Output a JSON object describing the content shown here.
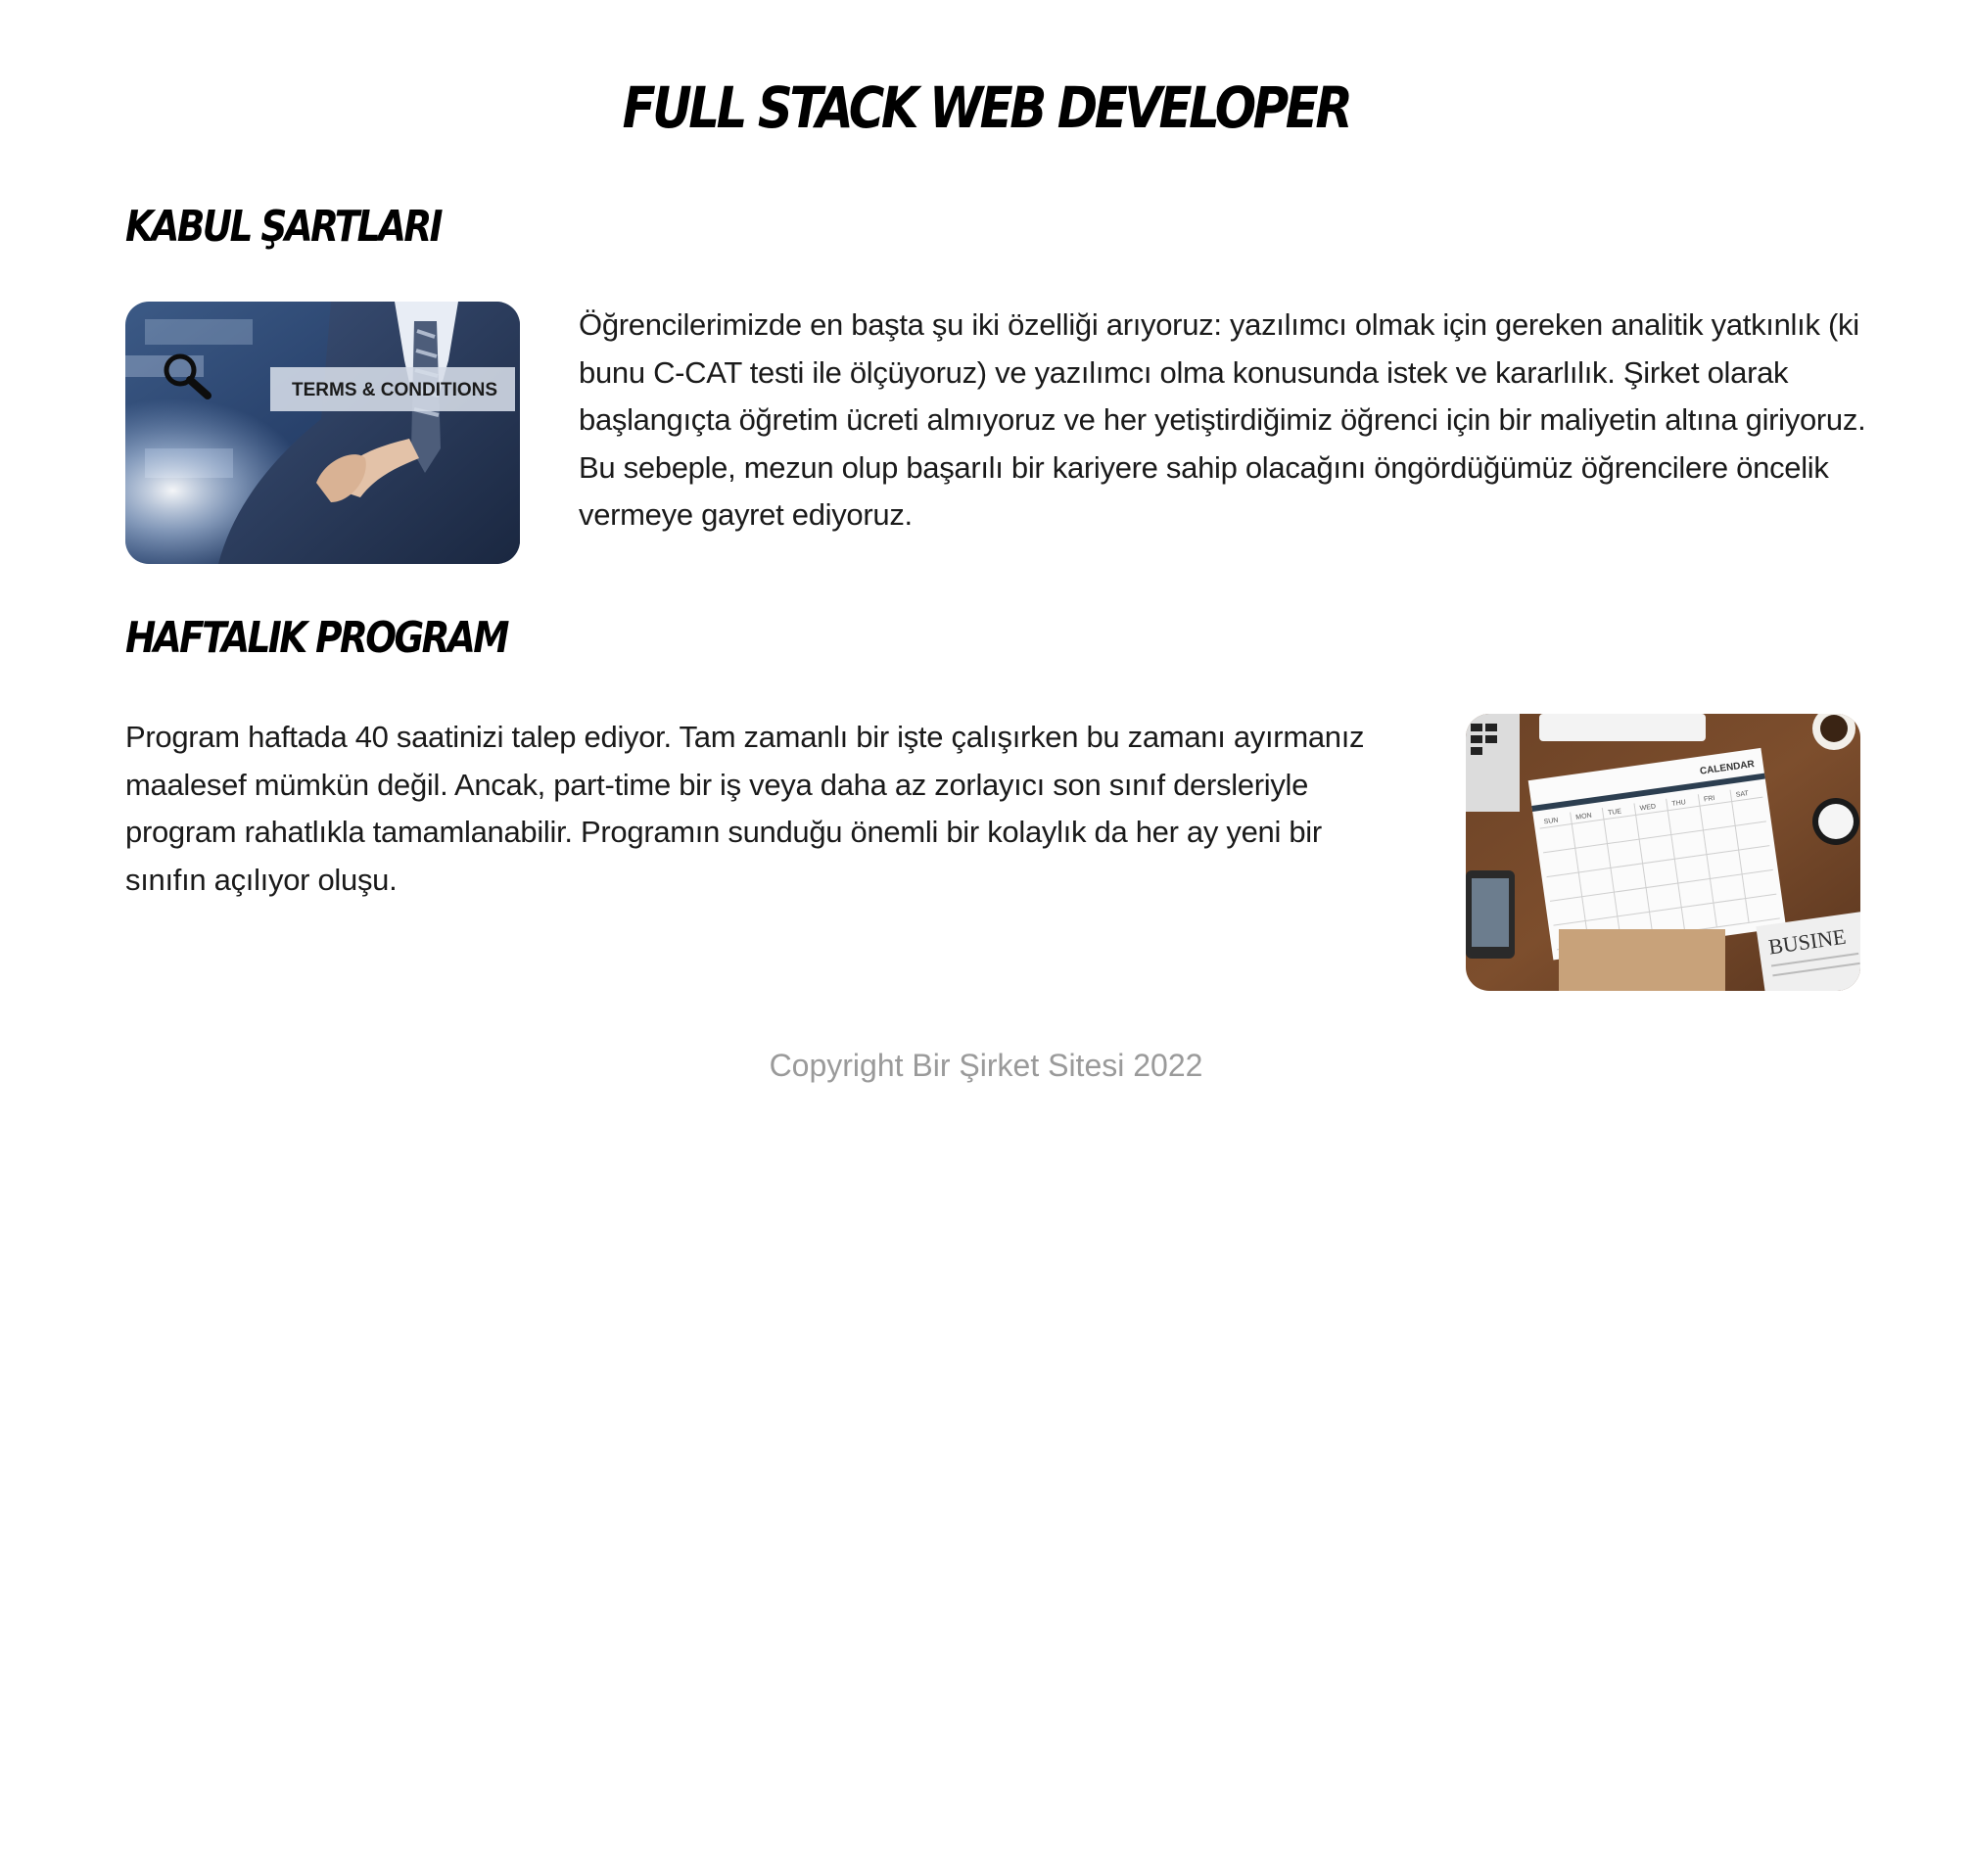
{
  "page": {
    "title": "FULL STACK WEB DEVELOPER"
  },
  "sections": [
    {
      "heading": "KABUL ŞARTLARI",
      "text": "Öğrencilerimizde en başta şu iki özelliği arıyoruz: yazılımcı olmak için gereken analitik yatkınlık (ki bunu C-CAT testi ile ölçüyoruz) ve yazılımcı olma konusunda istek ve kararlılık. Şirket olarak başlangıçta öğretim ücreti almıyoruz ve her yetiştirdiğimiz öğrenci için bir maliyetin altına giriyoruz. Bu sebeple, mezun olup başarılı bir kariyere sahip olacağını öngördüğümüz öğrencilere öncelik vermeye gayret ediyoruz.",
      "image": {
        "icon": "terms-conditions-photo",
        "caption": "TERMS & CONDITIONS"
      }
    },
    {
      "heading": "HAFTALIK PROGRAM",
      "text": "Program haftada 40 saatinizi talep ediyor. Tam zamanlı bir işte çalışırken bu zamanı ayırmanız maalesef mümkün değil. Ancak, part-time bir iş veya daha az zorlayıcı son sınıf dersleriyle program rahatlıkla tamamlanabilir. Programın sunduğu önemli bir kolaylık da her ay yeni bir sınıfın açılıyor oluşu.",
      "image": {
        "icon": "calendar-desk-photo",
        "calendar_label": "CALENDAR",
        "newspaper_label": "BUSINE",
        "weekdays": [
          "SUN",
          "MON",
          "TUE",
          "WED",
          "THU",
          "FRI",
          "SAT"
        ]
      }
    }
  ],
  "footer": {
    "text": "Copyright Bir Şirket Sitesi 2022"
  }
}
